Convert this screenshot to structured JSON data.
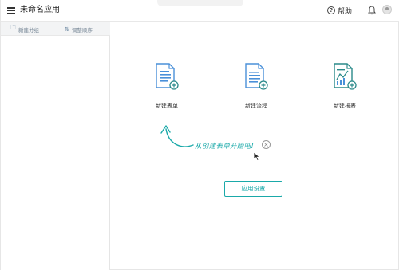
{
  "app": {
    "title": "未命名应用"
  },
  "header": {
    "help_label": "帮助"
  },
  "sidebar": {
    "new_group_label": "新建分组",
    "reorder_label": "调整顺序"
  },
  "main": {
    "cards": [
      {
        "label": "新建表单",
        "icon": "form-doc-add-icon"
      },
      {
        "label": "新建流程",
        "icon": "flow-doc-add-icon"
      },
      {
        "label": "新建报表",
        "icon": "report-chart-add-icon"
      }
    ],
    "hint_text": "从创建表单开始吧!",
    "settings_label": "应用设置"
  },
  "colors": {
    "accent": "#1aa9a9",
    "icon_blue": "#4a90d9",
    "text": "#333333",
    "sidebar_bg": "#f3f4f5"
  }
}
